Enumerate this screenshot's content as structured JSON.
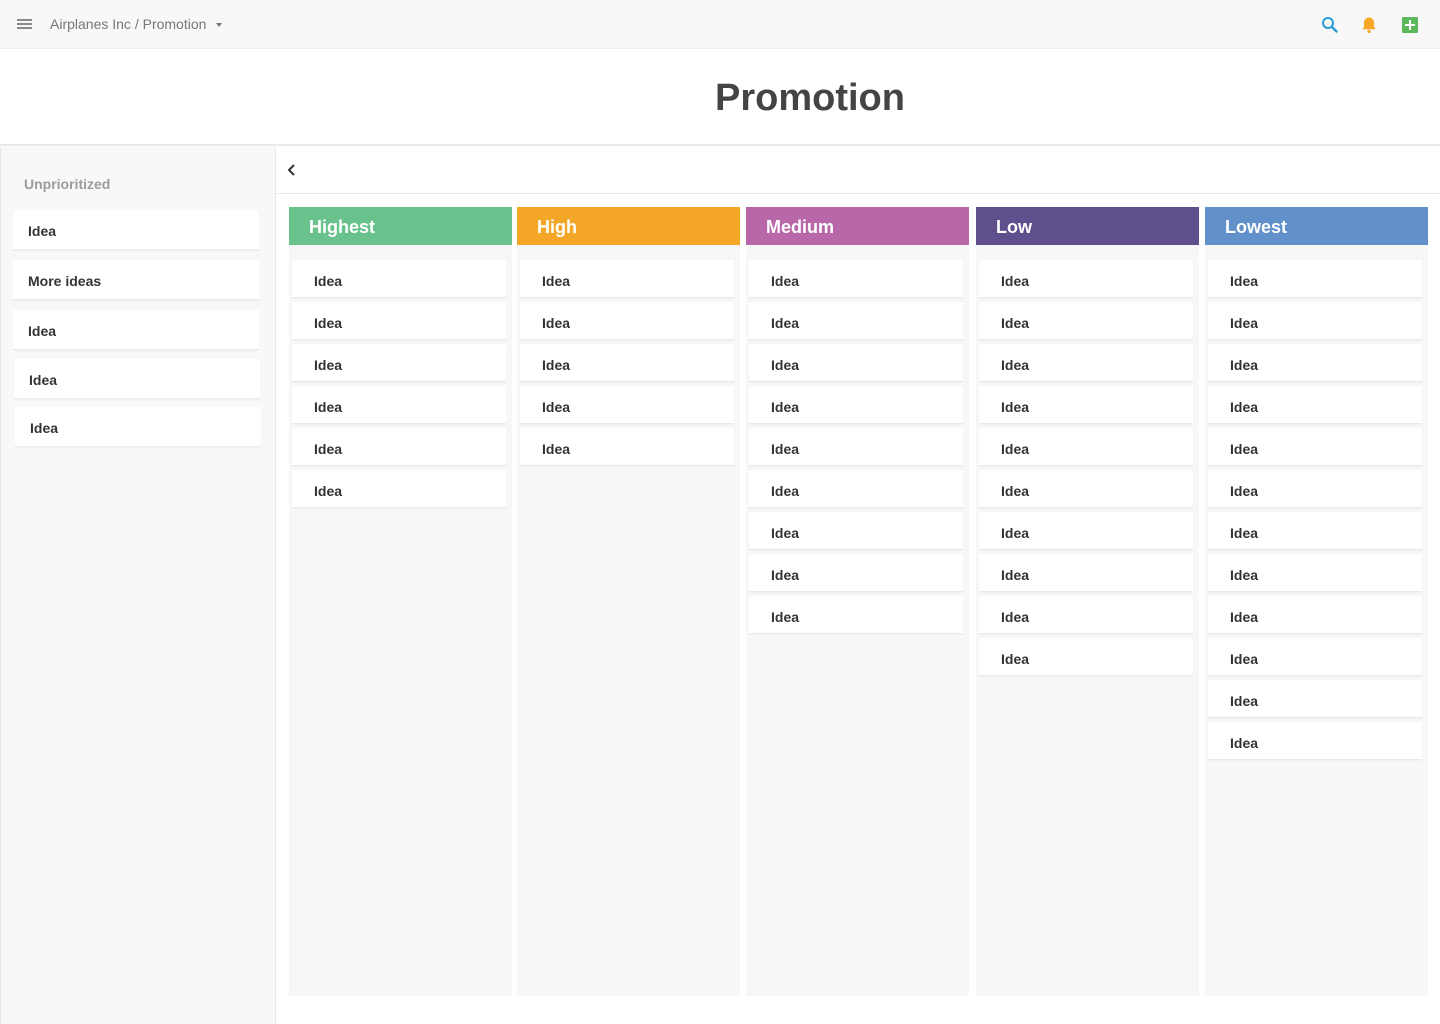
{
  "header": {
    "breadcrumb": "Airplanes Inc / Promotion",
    "icons": [
      "menu-icon",
      "chevron-down-icon",
      "search-icon",
      "bell-icon",
      "add-icon"
    ],
    "colors": {
      "search": "#2a9bd3",
      "bell": "#f5a623",
      "add": "#5cb85c"
    }
  },
  "page": {
    "title": "Promotion"
  },
  "sidebar": {
    "heading": "Unprioritized",
    "items": [
      {
        "label": "Idea"
      },
      {
        "label": "More ideas"
      },
      {
        "label": "Idea"
      },
      {
        "label": "Idea"
      },
      {
        "label": "Idea"
      }
    ]
  },
  "board": {
    "columns": [
      {
        "name": "Highest",
        "color": "#69c28b",
        "cards": [
          "Idea",
          "Idea",
          "Idea",
          "Idea",
          "Idea",
          "Idea"
        ]
      },
      {
        "name": "High",
        "color": "#f4a726",
        "cards": [
          "Idea",
          "Idea",
          "Idea",
          "Idea",
          "Idea"
        ]
      },
      {
        "name": "Medium",
        "color": "#b868a8",
        "cards": [
          "Idea",
          "Idea",
          "Idea",
          "Idea",
          "Idea",
          "Idea",
          "Idea",
          "Idea",
          "Idea"
        ]
      },
      {
        "name": "Low",
        "color": "#5f4f8c",
        "cards": [
          "Idea",
          "Idea",
          "Idea",
          "Idea",
          "Idea",
          "Idea",
          "Idea",
          "Idea",
          "Idea",
          "Idea"
        ]
      },
      {
        "name": "Lowest",
        "color": "#6190ca",
        "cards": [
          "Idea",
          "Idea",
          "Idea",
          "Idea",
          "Idea",
          "Idea",
          "Idea",
          "Idea",
          "Idea",
          "Idea",
          "Idea",
          "Idea"
        ]
      }
    ]
  }
}
